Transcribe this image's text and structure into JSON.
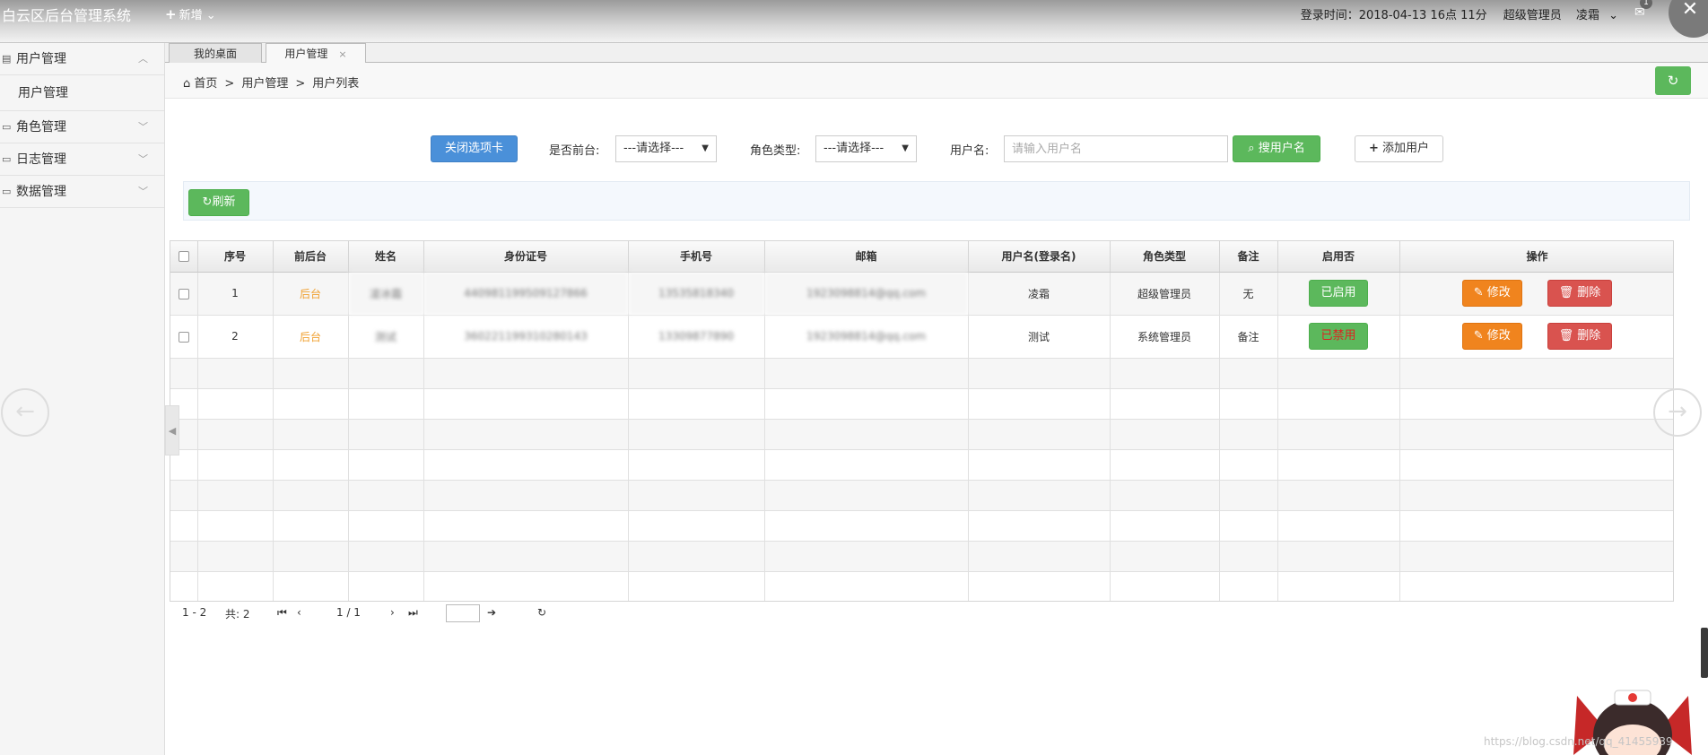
{
  "header": {
    "app_title": "白云区后台管理系统",
    "new_label": "新增",
    "login_label": "登录时间：2018-04-13 16点 11分",
    "role": "超级管理员",
    "user": "凌霜",
    "mail_count": "1"
  },
  "sidebar": {
    "groups": [
      {
        "label": "用户管理",
        "items": [
          "用户管理"
        ]
      },
      {
        "label": "角色管理"
      },
      {
        "label": "日志管理"
      },
      {
        "label": "数据管理"
      }
    ]
  },
  "tabs": [
    {
      "label": "我的桌面"
    },
    {
      "label": "用户管理"
    }
  ],
  "breadcrumb": [
    "首页",
    "用户管理",
    "用户列表"
  ],
  "filters": {
    "close_tabs": "关闭选项卡",
    "frontend_label": "是否前台:",
    "frontend_value": "---请选择---",
    "role_label": "角色类型:",
    "role_value": "---请选择---",
    "username_label": "用户名:",
    "username_placeholder": "请输入用户名",
    "search_button": "搜用户名",
    "add_button": "添加用户",
    "refresh_button": "刷新"
  },
  "table": {
    "headers": [
      "序号",
      "前后台",
      "姓名",
      "身份证号",
      "手机号",
      "邮箱",
      "用户名(登录名)",
      "角色类型",
      "备注",
      "启用否",
      "操作"
    ],
    "rows": [
      {
        "index": "1",
        "side": "后台",
        "name": "凌冰霜",
        "id": "440981199509127866",
        "phone": "13535818340",
        "email": "1923098814@qq.com",
        "username": "凌霜",
        "role": "超级管理员",
        "remark": "无",
        "status": "已启用"
      },
      {
        "index": "2",
        "side": "后台",
        "name": "测试",
        "id": "360221199310280143",
        "phone": "13309877890",
        "email": "1923098814@qq.com",
        "username": "测试",
        "role": "系统管理员",
        "remark": "备注",
        "status": "已禁用"
      }
    ],
    "edit_label": "修改",
    "delete_label": "删除"
  },
  "pager": {
    "range": "1 - 2",
    "total": "共: 2",
    "page": "1 / 1"
  },
  "watermark": "https://blog.csdn.net/qq_41455939",
  "colors": {
    "green": "#5cb85c",
    "blue": "#4a90d9",
    "orange": "#f0841e",
    "red": "#d9534f"
  }
}
